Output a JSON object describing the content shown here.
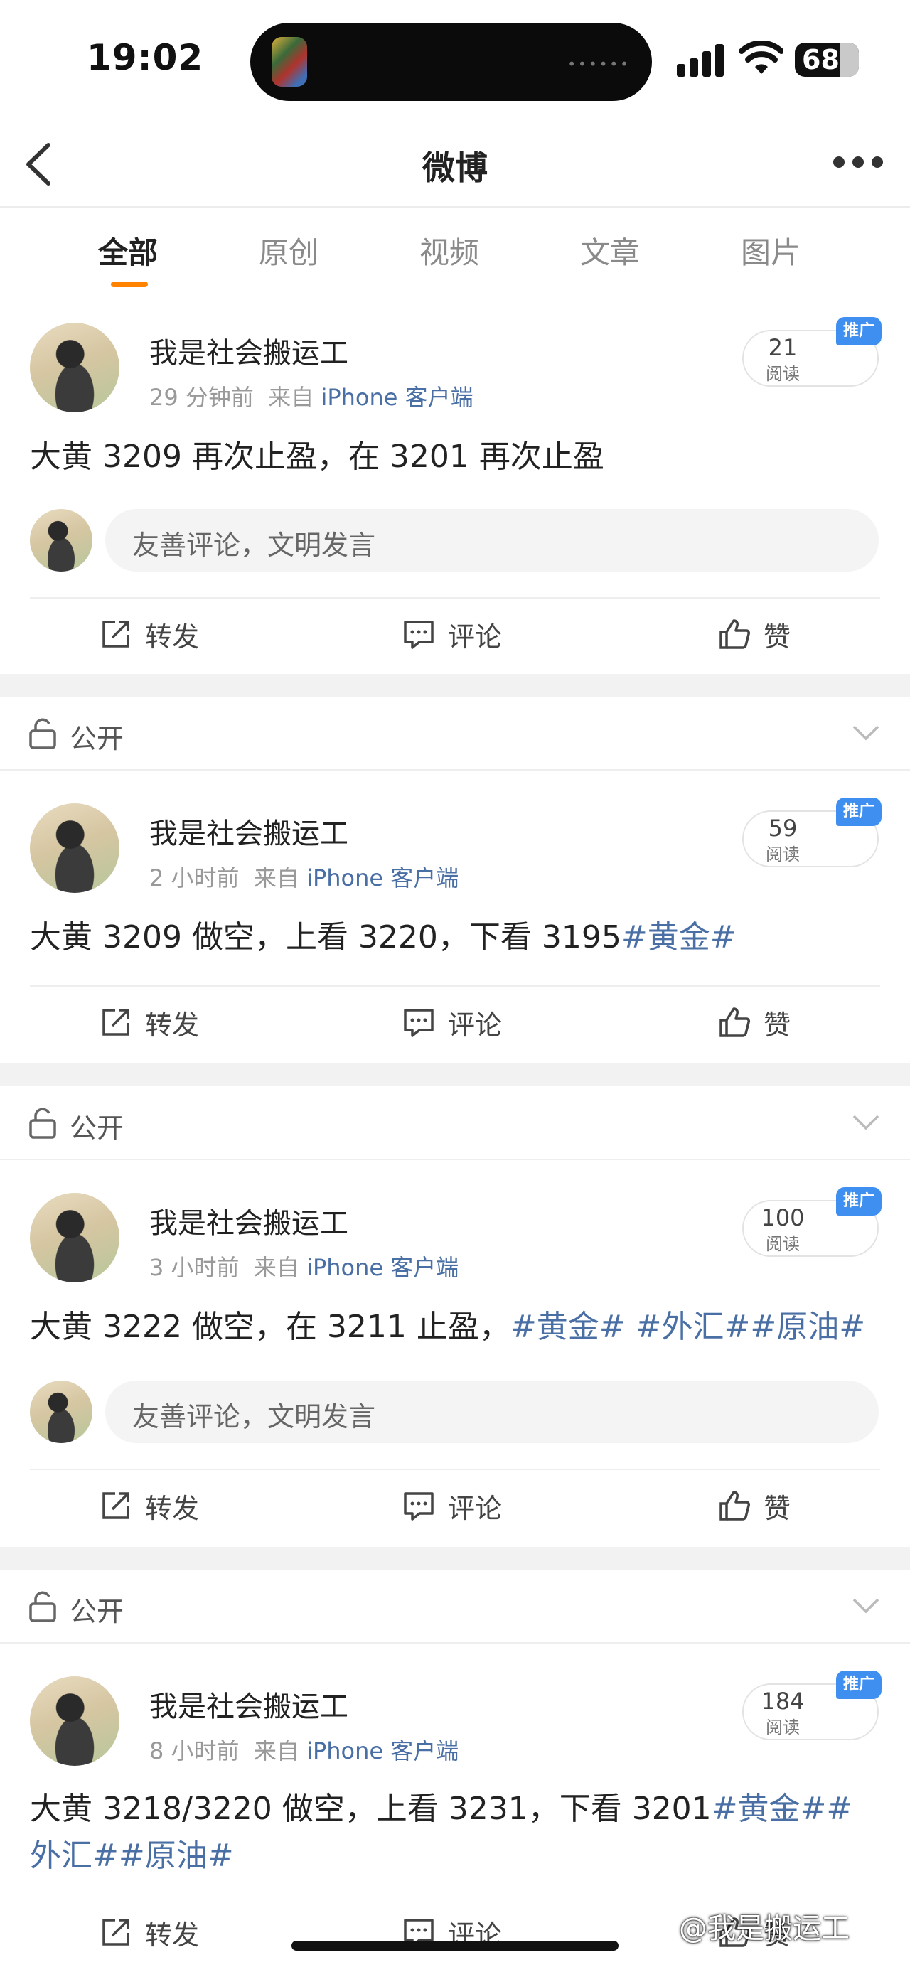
{
  "status_bar": {
    "time": "19:02",
    "battery": "68"
  },
  "nav": {
    "title": "微博"
  },
  "tabs": [
    {
      "label": "全部",
      "active": true
    },
    {
      "label": "原创"
    },
    {
      "label": "视频"
    },
    {
      "label": "文章"
    },
    {
      "label": "图片"
    }
  ],
  "comment_placeholder": "友善评论，文明发言",
  "actions": {
    "repost": "转发",
    "comment": "评论",
    "like": "赞"
  },
  "privacy_label": "公开",
  "promo_badge": "推广",
  "read_label": "阅读",
  "posts": [
    {
      "username": "我是社会搬运工",
      "time": "29 分钟前",
      "from": "来自",
      "source": "iPhone 客户端",
      "reads": "21",
      "text": "大黄 3209 再次止盈，在 3201 再次止盈",
      "tags": ""
    },
    {
      "username": "我是社会搬运工",
      "time": "2 小时前",
      "from": "来自",
      "source": "iPhone 客户端",
      "reads": "59",
      "text": "大黄 3209 做空，上看 3220，下看 3195",
      "tags": "#黄金#"
    },
    {
      "username": "我是社会搬运工",
      "time": "3 小时前",
      "from": "来自",
      "source": "iPhone 客户端",
      "reads": "100",
      "text": "大黄 3222 做空，在 3211 止盈，",
      "tags": "#黄金# #外汇##原油#"
    },
    {
      "username": "我是社会搬运工",
      "time": "8 小时前",
      "from": "来自",
      "source": "iPhone 客户端",
      "reads": "184",
      "text": "大黄 3218/3220 做空，上看 3231，下看 3201",
      "tags": "#黄金##外汇##原油#"
    }
  ],
  "watermark": "@我是搬运工",
  "colors": {
    "accent": "#ff8200",
    "link": "#4a6fa5",
    "promo": "#3f8ff0"
  }
}
